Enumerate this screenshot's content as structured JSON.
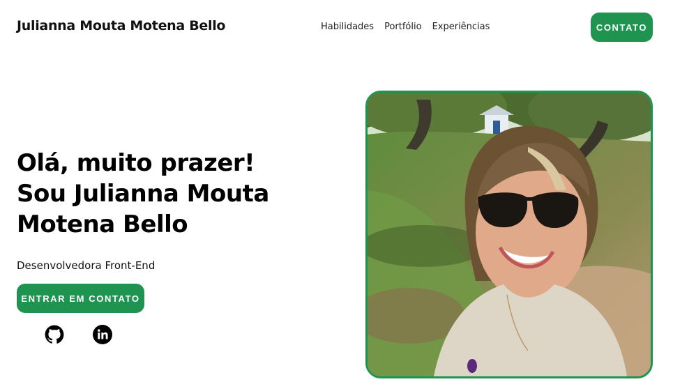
{
  "header": {
    "logo": "Julianna Mouta Motena Bello",
    "nav": [
      "Habilidades",
      "Portfólio",
      "Experiências"
    ],
    "contact_button": "CONTATO"
  },
  "hero": {
    "title_lines": [
      "Olá, muito prazer!",
      "Sou Julianna Mouta",
      "Motena Bello"
    ],
    "subtitle": "Desenvolvedora Front-End",
    "cta_button": "ENTRAR EM CONTATO",
    "social": [
      {
        "icon": "github-icon"
      },
      {
        "icon": "linkedin-icon"
      }
    ],
    "photo": {
      "description_icon": "profile-photo"
    }
  },
  "colors": {
    "accent": "#1f9450",
    "text": "#111111",
    "background": "#ffffff"
  }
}
